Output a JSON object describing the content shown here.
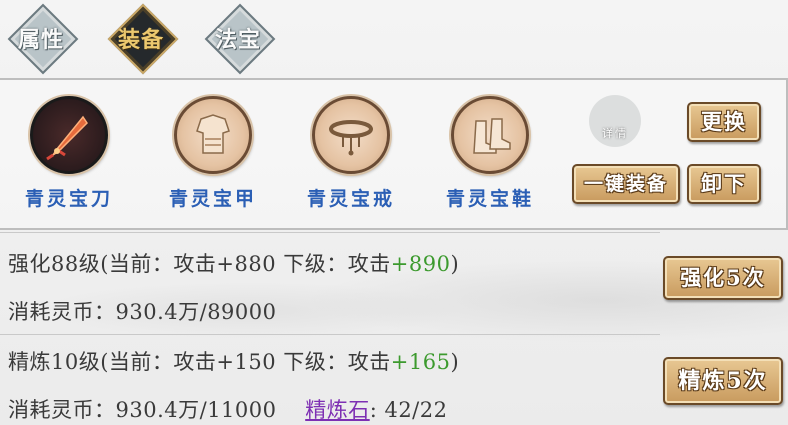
{
  "tabs": [
    {
      "label": "属性",
      "active": false
    },
    {
      "label": "装备",
      "active": true
    },
    {
      "label": "法宝",
      "active": false
    }
  ],
  "equipment": [
    {
      "name": "青灵宝刀",
      "icon": "blade-icon"
    },
    {
      "name": "青灵宝甲",
      "icon": "armor-icon"
    },
    {
      "name": "青灵宝戒",
      "icon": "ring-belt-icon"
    },
    {
      "name": "青灵宝鞋",
      "icon": "boots-icon"
    }
  ],
  "detail_label": "详情",
  "buttons": {
    "replace": "更换",
    "one_key_equip": "一键装备",
    "unequip": "卸下",
    "enhance": "强化5次",
    "refine": "精炼5次"
  },
  "enhance": {
    "level_text": "强化88级(当前：攻击+880 下级：攻击",
    "next_value": "+890",
    "close_paren": ")",
    "cost_text": "消耗灵币：930.4万/89000"
  },
  "refine": {
    "level_text": "精炼10级(当前：攻击+150 下级：攻击",
    "next_value": "+165",
    "close_paren": ")",
    "cost_text": "消耗灵币：930.4万/11000",
    "stone_label": "精炼石",
    "stone_value": ": 42/22"
  },
  "colors": {
    "item_name": "#2b5fb5",
    "bonus": "#3c9a2e",
    "stone_link": "#7d2fb3",
    "active_tab": "#25292c"
  }
}
